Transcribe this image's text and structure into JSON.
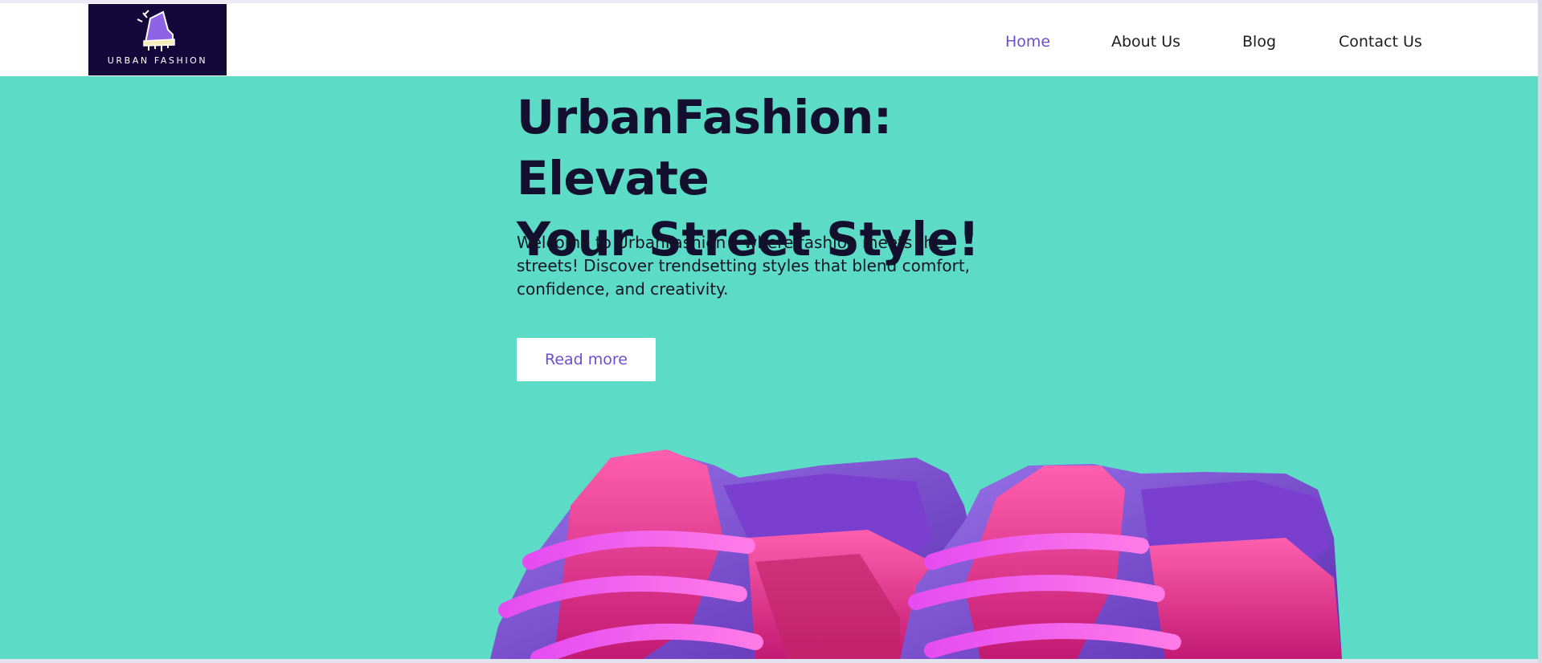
{
  "brand": {
    "name": "URBAN FASHION",
    "logo_icon": "sneaker-icon"
  },
  "nav": {
    "items": [
      {
        "label": "Home",
        "active": true
      },
      {
        "label": "About Us",
        "active": false
      },
      {
        "label": "Blog",
        "active": false
      },
      {
        "label": "Contact Us",
        "active": false
      }
    ]
  },
  "hero": {
    "title_line1": "UrbanFashion: Elevate",
    "title_line2": "Your Street Style!",
    "description_line1": "Welcome to UrbanFashion – where fashion meets the",
    "description_line2": "streets! Discover trendsetting styles that blend comfort,",
    "description_line3": "confidence, and creativity.",
    "cta_label": "Read more",
    "image": "pink-purple-sneakers"
  },
  "colors": {
    "hero_background": "#5cdcc6",
    "accent": "#6b4fd1",
    "logo_background": "#14083a",
    "heading": "#130f2e"
  }
}
